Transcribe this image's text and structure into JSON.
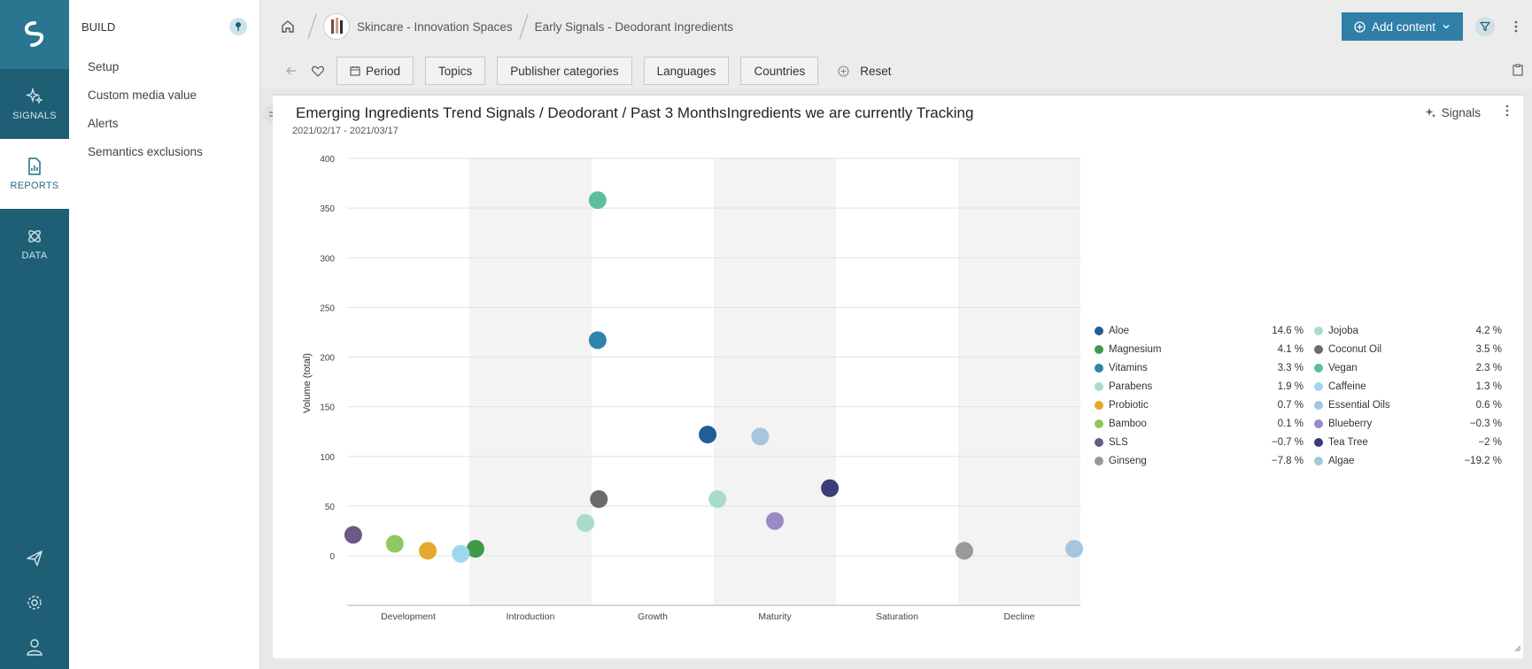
{
  "rail": {
    "items": [
      {
        "label": "SIGNALS"
      },
      {
        "label": "REPORTS"
      },
      {
        "label": "DATA"
      }
    ]
  },
  "build": {
    "title": "BUILD",
    "items": [
      "Setup",
      "Custom media value",
      "Alerts",
      "Semantics exclusions"
    ]
  },
  "topbar": {
    "crumb1": "Skincare - Innovation Spaces",
    "crumb2": "Early Signals - Deodorant Ingredients",
    "add_label": "Add content"
  },
  "filters": {
    "period": "Period",
    "topics": "Topics",
    "publisher": "Publisher categories",
    "languages": "Languages",
    "countries": "Countries",
    "reset": "Reset"
  },
  "widget": {
    "title": "Emerging Ingredients  Trend Signals / Deodorant / Past 3 MonthsIngredients we are currently Tracking",
    "date_range": "2021/02/17 - 2021/03/17",
    "signals_label": "Signals"
  },
  "chart_data": {
    "type": "scatter",
    "ylabel": "Volume (total)",
    "ylim": [
      -50,
      400
    ],
    "yticks": [
      0,
      50,
      100,
      150,
      200,
      250,
      300,
      350,
      400
    ],
    "categories": [
      "Development",
      "Introduction",
      "Growth",
      "Maturity",
      "Saturation",
      "Decline"
    ],
    "shaded_bands": [
      "Introduction",
      "Maturity",
      "Decline"
    ],
    "series": [
      {
        "name": "Aloe",
        "pct": "14.6 %",
        "color": "#1f5e96",
        "x": 2.95,
        "y": 122
      },
      {
        "name": "Jojoba",
        "pct": "4.2 %",
        "color": "#a7dccb",
        "x": 3.03,
        "y": 57
      },
      {
        "name": "Magnesium",
        "pct": "4.1 %",
        "color": "#3c9a49",
        "x": 1.05,
        "y": 7
      },
      {
        "name": "Coconut Oil",
        "pct": "3.5 %",
        "color": "#6b6b6b",
        "x": 2.06,
        "y": 57
      },
      {
        "name": "Vitamins",
        "pct": "3.3 %",
        "color": "#2f84ad",
        "x": 2.05,
        "y": 217
      },
      {
        "name": "Vegan",
        "pct": "2.3 %",
        "color": "#5cbf9c",
        "x": 2.05,
        "y": 358
      },
      {
        "name": "Parabens",
        "pct": "1.9 %",
        "color": "#a7dccb",
        "x": 1.95,
        "y": 33
      },
      {
        "name": "Caffeine",
        "pct": "1.3 %",
        "color": "#9fd8ee",
        "x": 0.93,
        "y": 2
      },
      {
        "name": "Probiotic",
        "pct": "0.7 %",
        "color": "#e6a82c",
        "x": 0.66,
        "y": 5
      },
      {
        "name": "Essential Oils",
        "pct": "0.6 %",
        "color": "#a5c6dd",
        "x": 3.38,
        "y": 120
      },
      {
        "name": "Bamboo",
        "pct": "0.1 %",
        "color": "#8fc860",
        "x": 0.39,
        "y": 12
      },
      {
        "name": "Blueberry",
        "pct": "−0.3 %",
        "color": "#9b88c6",
        "x": 3.5,
        "y": 35
      },
      {
        "name": "SLS",
        "pct": "−0.7 %",
        "color": "#6b5a85",
        "x": 0.05,
        "y": 21
      },
      {
        "name": "Tea Tree",
        "pct": "−2 %",
        "color": "#3a3d78",
        "x": 3.95,
        "y": 68
      },
      {
        "name": "Ginseng",
        "pct": "−7.8 %",
        "color": "#999999",
        "x": 5.05,
        "y": 5
      },
      {
        "name": "Algae",
        "pct": "−19.2 %",
        "color": "#a5c6dd",
        "x": 5.95,
        "y": 7
      }
    ]
  }
}
